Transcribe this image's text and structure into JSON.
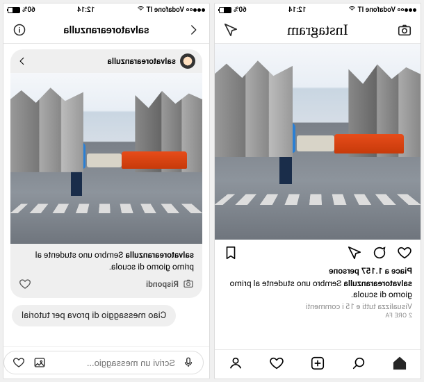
{
  "status": {
    "carrier": "Vodafone IT",
    "time": "12:14",
    "battery_pct": "60%"
  },
  "dm": {
    "header_title": "salvatorearanzulla",
    "reply": {
      "username": "salvatorearanzulla",
      "caption_user": "salvatorearanzulla",
      "caption_text": "Sembro uno studente al primo giorno di scuola.",
      "reply_label": "Rispondi"
    },
    "outgoing": "Ciao messaggio di prova per tutorial",
    "input_placeholder": "Scrivi un messaggio..."
  },
  "feed": {
    "logo_text": "Instagram",
    "likes": "Piace a 1.157 persone",
    "caption_user": "salvatorearanzulla",
    "caption_text": "Sembro uno studente al primo giorno di scuola.",
    "view_comments": "Visualizza tutti e 15 i commenti",
    "time_ago": "2 ORE FA"
  },
  "icons": {
    "back": "chevron-left-icon",
    "info": "info-icon",
    "camera_small": "camera-icon",
    "heart_outline": "heart-icon",
    "gallery": "gallery-icon",
    "mic": "mic-icon",
    "camera_circle": "camera-icon",
    "comment": "comment-icon",
    "send": "paper-plane-icon",
    "bookmark": "bookmark-icon",
    "home": "home-icon",
    "search": "search-icon",
    "add": "add-post-icon",
    "activity": "heart-icon",
    "profile": "profile-icon"
  }
}
